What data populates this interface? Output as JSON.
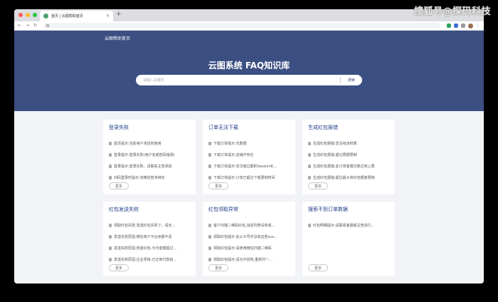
{
  "watermark": "搜狐号@探码科技",
  "browser": {
    "tab_title": "首页 | 云图帮助首页",
    "tab_close": "×",
    "new_tab": "+",
    "nav_back": "←",
    "nav_forward": "→",
    "nav_reload": "↻",
    "menu": "⋮"
  },
  "page": {
    "nav_title": "云图帮助首页",
    "hero_title": "云图系统 FAQ知识库",
    "search": {
      "placeholder": "请输入关键字",
      "button_label": "搜索"
    },
    "more_label": "更多",
    "categories": [
      {
        "title": "登录失败",
        "items": [
          "首页提示:当前用户未授权使用",
          "登录提示:登录失败(用户名或密码错误)",
          "登录提示:登录失败。请联系主管添加",
          "扫码登录时提示:该微信暂未绑定"
        ]
      },
      {
        "title": "订单无法下载",
        "items": [
          "下载订单提示:无数据",
          "下载订单提示:店铺不存在",
          "下载订单提示:非法或过期的SessionK...",
          "下载订单提示:订单已超过下载限制时间"
        ]
      },
      {
        "title": "生成红包报错",
        "items": [
          "生成红包报错:您没有该权限",
          "生成红包报错:超过限额限制",
          "生成红包报错:此订单客服次数达到上限",
          "生成红包报错:超过最大单红包额度限制"
        ]
      },
      {
        "title": "红包发送失败",
        "items": [
          "领取红包失败:发送红包失败了。请长...",
          "发送失败原因:微信商户平台余额不足",
          "发送失败原因:现金红包-今日金额超过...",
          "发送失败原因:企业零钱-已达到付款给..."
        ]
      },
      {
        "title": "红包领取异常",
        "items": [
          "客户扫描二维码红包,消息列表没有收...",
          "领取红包提示:此公众号并没有这些sco...",
          "领取红包提示:请使用微信扫描二维码",
          "领取红包提示:请允许授权,重新扫一..."
        ]
      },
      {
        "title": "搜索不到订单数据",
        "items": [
          "红包明细提示:请联系客服或主管进行..."
        ]
      }
    ]
  },
  "colors": {
    "hero_background": "#3c4f83",
    "card_title": "#1f3c88"
  }
}
